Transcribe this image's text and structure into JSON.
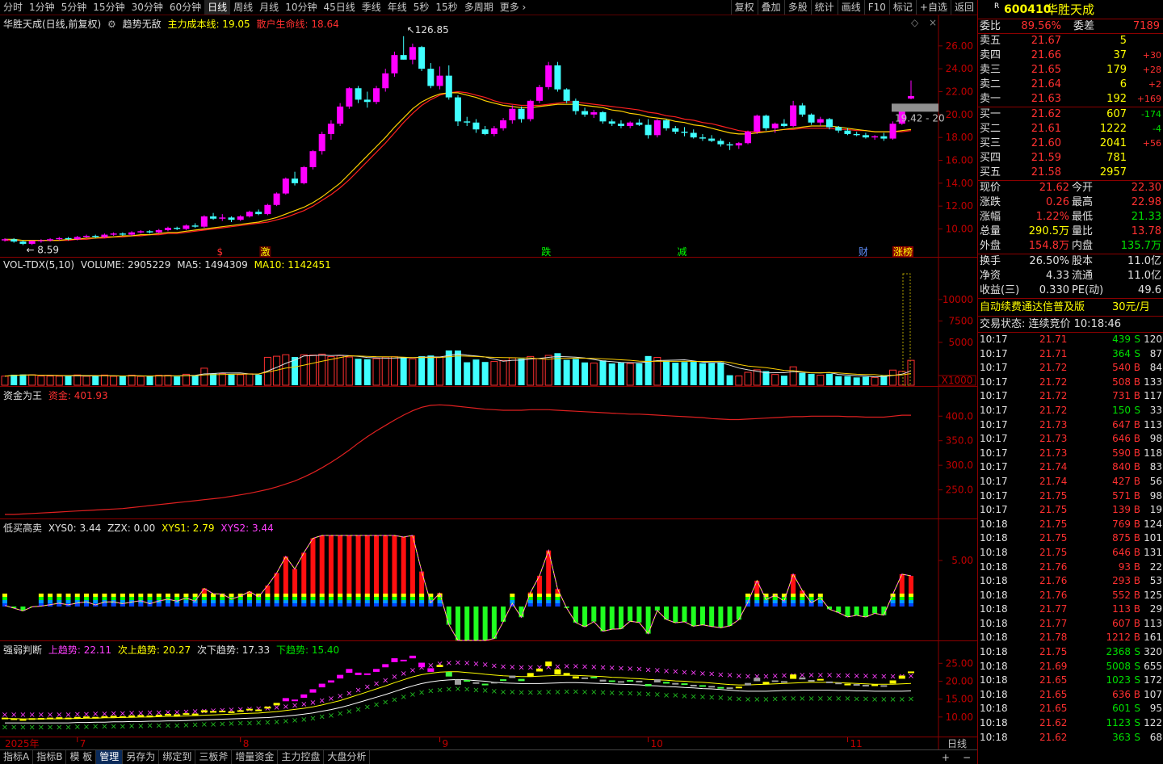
{
  "toolbar": {
    "tabs": [
      "分时",
      "1分钟",
      "5分钟",
      "15分钟",
      "30分钟",
      "60分钟",
      "日线",
      "周线",
      "月线",
      "10分钟",
      "45日线",
      "季线",
      "年线",
      "5秒",
      "15秒",
      "多周期",
      "更多 ›"
    ],
    "active": "日线",
    "right": [
      "复权",
      "叠加",
      "多股",
      "统计",
      "画线",
      "F10",
      "标记",
      "+自选",
      "返回"
    ]
  },
  "kline": {
    "stock_label": "华胜天成(日线,前复权)",
    "indicator": "趋势无敌",
    "line1_label": "主力成本线: 19.05",
    "line2_label": "散户生命线: 18.64",
    "high_mark": "126.85",
    "low_mark": "8.59",
    "last_price_tag": "19.42 - 20",
    "yaxis": [
      "26.00",
      "24.00",
      "22.00",
      "20.00",
      "18.00",
      "16.00",
      "14.00",
      "12.00",
      "10.00"
    ],
    "markers": [
      "$",
      "激",
      "跌",
      "减",
      "财",
      "涨榜"
    ],
    "colors": {
      "up": "#ff00ff",
      "down": "#40ffff",
      "ma1": "#ffd000",
      "ma2": "#ff2020"
    }
  },
  "volume": {
    "title": "VOL-TDX(5,10)",
    "volume": "VOLUME: 2905229",
    "ma5": "MA5: 1494309",
    "ma10": "MA10: 1142451",
    "yaxis": [
      "10000",
      "7500",
      "5000"
    ],
    "unit": "X1000"
  },
  "fund": {
    "title": "资金为王",
    "label": "资金: 401.93",
    "yaxis": [
      "400.0",
      "350.0",
      "300.0",
      "250.0"
    ]
  },
  "lowbuy": {
    "title": "低买高卖",
    "xys0": "XYS0: 3.44",
    "zzx": "ZZX: 0.00",
    "xys1": "XYS1: 2.79",
    "xys2": "XYS2: 3.44",
    "yaxis": [
      "5.00"
    ]
  },
  "strength": {
    "title": "强弱判断",
    "up": "上趋势: 22.11",
    "nextup": "次上趋势: 20.27",
    "nextdown": "次下趋势: 17.33",
    "down": "下趋势: 15.40",
    "yaxis": [
      "25.00",
      "20.00",
      "15.00",
      "10.00"
    ]
  },
  "dates": {
    "year": "2025年",
    "months": [
      "7",
      "8",
      "9",
      "10",
      "11"
    ],
    "period": "日线"
  },
  "bottom": {
    "items": [
      "指标A",
      "指标B",
      "模 板",
      "管理",
      "另存为",
      "绑定到",
      "三板斧",
      "增量资金",
      "主力控盘",
      "大盘分析"
    ],
    "active": "管理"
  },
  "side": {
    "code": "600410",
    "name": "华胜天成",
    "weibi_label": "委比",
    "weibi": "89.56%",
    "weicha_label": "委差",
    "weicha": "7189",
    "asks": [
      {
        "label": "卖五",
        "price": "21.67",
        "vol": "5",
        "chg": ""
      },
      {
        "label": "卖四",
        "price": "21.66",
        "vol": "37",
        "chg": "+30"
      },
      {
        "label": "卖三",
        "price": "21.65",
        "vol": "179",
        "chg": "+28"
      },
      {
        "label": "卖二",
        "price": "21.64",
        "vol": "6",
        "chg": "+2"
      },
      {
        "label": "卖一",
        "price": "21.63",
        "vol": "192",
        "chg": "+169"
      }
    ],
    "bids": [
      {
        "label": "买一",
        "price": "21.62",
        "vol": "607",
        "chg": "-174"
      },
      {
        "label": "买二",
        "price": "21.61",
        "vol": "1222",
        "chg": "-4"
      },
      {
        "label": "买三",
        "price": "21.60",
        "vol": "2041",
        "chg": "+56"
      },
      {
        "label": "买四",
        "price": "21.59",
        "vol": "781",
        "chg": ""
      },
      {
        "label": "买五",
        "price": "21.58",
        "vol": "2957",
        "chg": ""
      }
    ],
    "quote": [
      {
        "l": "现价",
        "v": "21.62",
        "l2": "今开",
        "v2": "22.30"
      },
      {
        "l": "涨跌",
        "v": "0.26",
        "l2": "最高",
        "v2": "22.98"
      },
      {
        "l": "涨幅",
        "v": "1.22%",
        "l2": "最低",
        "v2": "21.33"
      },
      {
        "l": "总量",
        "v": "290.5万",
        "l2": "量比",
        "v2": "13.78"
      },
      {
        "l": "外盘",
        "v": "154.8万",
        "l2": "内盘",
        "v2": "135.7万"
      }
    ],
    "fin": [
      {
        "l": "换手",
        "v": "26.50%",
        "l2": "股本",
        "v2": "11.0亿"
      },
      {
        "l": "净资",
        "v": "4.33",
        "l2": "流通",
        "v2": "11.0亿"
      },
      {
        "l": "收益(三)",
        "v": "0.330",
        "l2": "PE(动)",
        "v2": "49.6"
      }
    ],
    "promo": "自动续费通达信普及版",
    "promo_price": "30元/月",
    "status": "交易状态: 连续竞价 10:18:46",
    "ticks": [
      [
        "10:17",
        "21.71",
        "439",
        "S",
        "120"
      ],
      [
        "10:17",
        "21.71",
        "364",
        "S",
        "87"
      ],
      [
        "10:17",
        "21.72",
        "540",
        "B",
        "84"
      ],
      [
        "10:17",
        "21.72",
        "508",
        "B",
        "133"
      ],
      [
        "10:17",
        "21.72",
        "731",
        "B",
        "117"
      ],
      [
        "10:17",
        "21.72",
        "150",
        "S",
        "33"
      ],
      [
        "10:17",
        "21.73",
        "647",
        "B",
        "113"
      ],
      [
        "10:17",
        "21.73",
        "646",
        "B",
        "98"
      ],
      [
        "10:17",
        "21.73",
        "590",
        "B",
        "118"
      ],
      [
        "10:17",
        "21.74",
        "840",
        "B",
        "83"
      ],
      [
        "10:17",
        "21.74",
        "427",
        "B",
        "56"
      ],
      [
        "10:17",
        "21.75",
        "571",
        "B",
        "98"
      ],
      [
        "10:17",
        "21.75",
        "139",
        "B",
        "19"
      ],
      [
        "10:18",
        "21.75",
        "769",
        "B",
        "124"
      ],
      [
        "10:18",
        "21.75",
        "875",
        "B",
        "101"
      ],
      [
        "10:18",
        "21.75",
        "646",
        "B",
        "131"
      ],
      [
        "10:18",
        "21.76",
        "93",
        "B",
        "22"
      ],
      [
        "10:18",
        "21.76",
        "293",
        "B",
        "53"
      ],
      [
        "10:18",
        "21.76",
        "552",
        "B",
        "125"
      ],
      [
        "10:18",
        "21.77",
        "113",
        "B",
        "29"
      ],
      [
        "10:18",
        "21.77",
        "607",
        "B",
        "113"
      ],
      [
        "10:18",
        "21.78",
        "1212",
        "B",
        "161"
      ],
      [
        "10:18",
        "21.75",
        "2368",
        "S",
        "320"
      ],
      [
        "10:18",
        "21.69",
        "5008",
        "S",
        "655"
      ],
      [
        "10:18",
        "21.65",
        "1023",
        "S",
        "172"
      ],
      [
        "10:18",
        "21.65",
        "636",
        "B",
        "107"
      ],
      [
        "10:18",
        "21.65",
        "601",
        "S",
        "95"
      ],
      [
        "10:18",
        "21.62",
        "1123",
        "S",
        "122"
      ],
      [
        "10:18",
        "21.62",
        "363",
        "S",
        "68"
      ]
    ]
  },
  "chart_data": {
    "type": "candlestick",
    "ohlc": [
      [
        9.0,
        9.2,
        8.9,
        9.1
      ],
      [
        9.1,
        9.2,
        8.8,
        8.9
      ],
      [
        8.9,
        9.0,
        8.59,
        8.7
      ],
      [
        8.7,
        9.0,
        8.6,
        8.95
      ],
      [
        8.95,
        9.1,
        8.8,
        9.0
      ],
      [
        9.0,
        9.2,
        8.9,
        9.1
      ],
      [
        9.1,
        9.3,
        9.0,
        9.2
      ],
      [
        9.2,
        9.3,
        9.0,
        9.1
      ],
      [
        9.1,
        9.4,
        9.0,
        9.3
      ],
      [
        9.3,
        9.5,
        9.2,
        9.4
      ],
      [
        9.4,
        9.5,
        9.2,
        9.3
      ],
      [
        9.3,
        9.6,
        9.2,
        9.5
      ],
      [
        9.5,
        9.7,
        9.4,
        9.6
      ],
      [
        9.6,
        9.7,
        9.4,
        9.5
      ],
      [
        9.5,
        9.8,
        9.4,
        9.7
      ],
      [
        9.7,
        9.9,
        9.6,
        9.8
      ],
      [
        9.8,
        9.9,
        9.6,
        9.7
      ],
      [
        9.7,
        10.0,
        9.6,
        9.9
      ],
      [
        9.9,
        10.2,
        9.8,
        10.1
      ],
      [
        10.1,
        10.2,
        9.9,
        10.0
      ],
      [
        10.0,
        10.4,
        9.9,
        10.3
      ],
      [
        10.3,
        10.5,
        10.1,
        10.2
      ],
      [
        10.2,
        11.2,
        10.1,
        11.1
      ],
      [
        11.1,
        11.4,
        10.8,
        10.9
      ],
      [
        10.9,
        11.3,
        10.7,
        11.0
      ],
      [
        11.0,
        11.1,
        10.6,
        10.8
      ],
      [
        10.8,
        11.2,
        10.7,
        11.1
      ],
      [
        11.1,
        11.6,
        11.0,
        11.5
      ],
      [
        11.5,
        11.7,
        11.2,
        11.3
      ],
      [
        11.3,
        12.2,
        11.2,
        12.1
      ],
      [
        12.1,
        13.2,
        12.0,
        13.1
      ],
      [
        13.1,
        14.5,
        13.0,
        14.4
      ],
      [
        14.4,
        15.0,
        13.8,
        14.0
      ],
      [
        14.0,
        15.5,
        13.9,
        15.4
      ],
      [
        15.4,
        16.9,
        15.2,
        16.8
      ],
      [
        16.8,
        18.5,
        16.5,
        18.3
      ],
      [
        18.3,
        19.5,
        17.8,
        19.2
      ],
      [
        19.2,
        21.0,
        19.0,
        20.7
      ],
      [
        20.7,
        22.4,
        20.5,
        22.3
      ],
      [
        22.3,
        22.5,
        21.0,
        21.3
      ],
      [
        21.3,
        22.0,
        20.6,
        21.1
      ],
      [
        21.1,
        22.5,
        20.9,
        22.3
      ],
      [
        22.3,
        24.0,
        22.0,
        23.6
      ],
      [
        23.6,
        25.5,
        23.3,
        25.2
      ],
      [
        25.2,
        26.85,
        24.8,
        24.8
      ],
      [
        24.8,
        26.2,
        24.4,
        25.9
      ],
      [
        25.9,
        26.0,
        23.8,
        24.0
      ],
      [
        24.0,
        24.5,
        22.3,
        22.5
      ],
      [
        22.5,
        24.2,
        22.2,
        23.4
      ],
      [
        23.4,
        24.3,
        21.3,
        21.5
      ],
      [
        21.5,
        21.7,
        19.0,
        19.4
      ],
      [
        19.4,
        19.8,
        19.0,
        19.3
      ],
      [
        19.3,
        19.6,
        18.4,
        18.7
      ],
      [
        18.7,
        19.0,
        18.2,
        18.3
      ],
      [
        18.3,
        19.0,
        18.1,
        18.8
      ],
      [
        18.8,
        19.7,
        18.6,
        19.5
      ],
      [
        19.5,
        20.8,
        19.2,
        20.5
      ],
      [
        20.5,
        20.7,
        19.3,
        19.6
      ],
      [
        19.6,
        21.3,
        19.4,
        21.2
      ],
      [
        21.2,
        22.6,
        21.0,
        22.4
      ],
      [
        22.4,
        24.6,
        22.2,
        24.3
      ],
      [
        24.3,
        24.6,
        22.0,
        22.2
      ],
      [
        22.2,
        22.3,
        21.0,
        21.2
      ],
      [
        21.2,
        21.4,
        20.0,
        20.3
      ],
      [
        20.3,
        20.6,
        19.8,
        20.0
      ],
      [
        20.0,
        20.4,
        19.7,
        20.2
      ],
      [
        20.2,
        20.3,
        19.2,
        19.4
      ],
      [
        19.4,
        19.6,
        19.0,
        19.2
      ],
      [
        19.2,
        19.5,
        18.8,
        19.0
      ],
      [
        19.0,
        19.4,
        18.8,
        19.3
      ],
      [
        19.3,
        19.6,
        19.0,
        19.1
      ],
      [
        19.1,
        19.6,
        17.9,
        18.2
      ],
      [
        18.2,
        19.6,
        18.0,
        19.5
      ],
      [
        19.5,
        19.6,
        18.6,
        18.8
      ],
      [
        18.8,
        19.0,
        18.3,
        18.5
      ],
      [
        18.5,
        18.9,
        18.1,
        18.4
      ],
      [
        18.4,
        18.7,
        17.9,
        18.0
      ],
      [
        18.0,
        18.3,
        17.7,
        17.9
      ],
      [
        17.9,
        18.2,
        17.6,
        17.7
      ],
      [
        17.7,
        17.9,
        17.2,
        17.4
      ],
      [
        17.4,
        17.6,
        16.9,
        17.3
      ],
      [
        17.3,
        17.6,
        17.0,
        17.5
      ],
      [
        17.5,
        18.6,
        17.4,
        18.5
      ],
      [
        18.5,
        20.0,
        18.3,
        19.9
      ],
      [
        19.9,
        20.0,
        18.6,
        18.8
      ],
      [
        18.8,
        19.3,
        18.4,
        19.2
      ],
      [
        19.2,
        19.6,
        18.9,
        19.0
      ],
      [
        19.0,
        21.2,
        18.9,
        20.8
      ],
      [
        20.8,
        21.0,
        19.8,
        20.0
      ],
      [
        20.0,
        20.1,
        19.1,
        19.3
      ],
      [
        19.3,
        19.8,
        19.0,
        19.6
      ],
      [
        19.6,
        19.7,
        18.7,
        18.9
      ],
      [
        18.9,
        19.0,
        18.4,
        18.6
      ],
      [
        18.6,
        18.8,
        18.2,
        18.3
      ],
      [
        18.3,
        18.5,
        18.1,
        18.2
      ],
      [
        18.2,
        18.4,
        17.9,
        18.0
      ],
      [
        18.0,
        18.2,
        17.8,
        18.1
      ],
      [
        18.1,
        18.4,
        17.7,
        17.9
      ],
      [
        17.9,
        19.4,
        17.8,
        19.2
      ],
      [
        19.2,
        20.6,
        19.1,
        20.5
      ],
      [
        21.4,
        22.98,
        21.33,
        21.62
      ]
    ],
    "ma1": [
      9.1,
      9.1,
      9.0,
      9.0,
      9.0,
      9.0,
      9.0,
      9.1,
      9.1,
      9.2,
      9.2,
      9.3,
      9.3,
      9.4,
      9.4,
      9.5,
      9.5,
      9.6,
      9.7,
      9.7,
      9.8,
      9.9,
      10.0,
      10.1,
      10.2,
      10.3,
      10.4,
      10.5,
      10.6,
      10.8,
      11.0,
      11.3,
      11.6,
      11.9,
      12.3,
      12.8,
      13.4,
      14.0,
      14.8,
      15.6,
      16.4,
      17.2,
      18.0,
      18.9,
      19.7,
      20.5,
      21.1,
      21.5,
      21.8,
      21.9,
      21.9,
      21.7,
      21.5,
      21.2,
      21.0,
      20.8,
      20.7,
      20.6,
      20.6,
      20.7,
      20.8,
      20.9,
      20.9,
      20.9,
      20.8,
      20.7,
      20.6,
      20.4,
      20.3,
      20.1,
      20.0,
      19.8,
      19.7,
      19.6,
      19.4,
      19.3,
      19.1,
      19.0,
      18.8,
      18.6,
      18.4,
      18.3,
      18.3,
      18.4,
      18.5,
      18.6,
      18.7,
      18.8,
      18.9,
      19.0,
      19.0,
      19.0,
      18.9,
      18.8,
      18.7,
      18.6,
      18.5,
      18.5,
      18.5,
      18.6,
      18.7
    ],
    "ma2": [
      9.0,
      9.0,
      9.0,
      9.0,
      9.0,
      9.0,
      9.0,
      9.0,
      9.1,
      9.1,
      9.2,
      9.2,
      9.3,
      9.3,
      9.4,
      9.4,
      9.5,
      9.5,
      9.6,
      9.6,
      9.7,
      9.8,
      9.9,
      10.0,
      10.1,
      10.2,
      10.3,
      10.4,
      10.5,
      10.6,
      10.8,
      11.0,
      11.3,
      11.6,
      12.0,
      12.5,
      13.0,
      13.6,
      14.3,
      15.1,
      15.9,
      16.7,
      17.5,
      18.4,
      19.3,
      20.1,
      20.8,
      21.3,
      21.7,
      21.9,
      22.0,
      21.9,
      21.7,
      21.5,
      21.2,
      21.0,
      20.9,
      20.8,
      20.8,
      20.8,
      20.9,
      21.0,
      21.1,
      21.1,
      21.0,
      20.9,
      20.8,
      20.7,
      20.6,
      20.5,
      20.4,
      20.2,
      20.1,
      19.9,
      19.8,
      19.6,
      19.5,
      19.3,
      19.2,
      19.0,
      18.8,
      18.6,
      18.5,
      18.5,
      18.5,
      18.6,
      18.7,
      18.7,
      18.8,
      18.8,
      18.8,
      18.8,
      18.7,
      18.7,
      18.6,
      18.6,
      18.5,
      18.5,
      18.5,
      18.5,
      18.6
    ],
    "fund": [
      200,
      200,
      201,
      202,
      203,
      204,
      205,
      206,
      207,
      208,
      209,
      210,
      211,
      212,
      214,
      216,
      218,
      220,
      222,
      224,
      226,
      228,
      230,
      232,
      234,
      237,
      240,
      243,
      247,
      251,
      256,
      262,
      268,
      276,
      285,
      295,
      306,
      318,
      331,
      345,
      358,
      370,
      381,
      392,
      402,
      411,
      418,
      422,
      423,
      422,
      420,
      418,
      416,
      414,
      413,
      412,
      412,
      412,
      413,
      413,
      413,
      412,
      411,
      410,
      409,
      408,
      407,
      406,
      405,
      404,
      404,
      403,
      402,
      401,
      400,
      399,
      398,
      397,
      395,
      394,
      393,
      393,
      394,
      395,
      396,
      397,
      398,
      399,
      399,
      400,
      400,
      400,
      400,
      399,
      399,
      398,
      398,
      398,
      400,
      401.93,
      401.93
    ]
  }
}
